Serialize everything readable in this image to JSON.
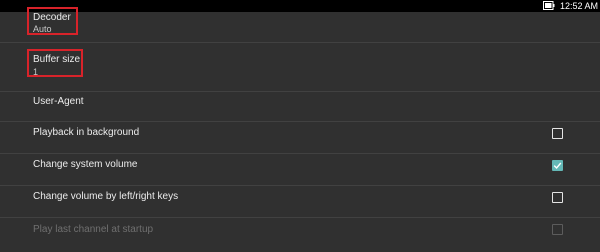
{
  "status_bar": {
    "time": "12:52 AM",
    "battery_icon": "battery-icon"
  },
  "settings": {
    "decoder": {
      "title": "Decoder",
      "summary": "Auto"
    },
    "buffer_size": {
      "title": "Buffer size",
      "summary": "1"
    },
    "user_agent": {
      "title": "User-Agent"
    },
    "playback_background": {
      "title": "Playback in background",
      "checked": false
    },
    "change_system_volume": {
      "title": "Change system volume",
      "checked": true
    },
    "change_volume_keys": {
      "title": "Change volume by left/right keys",
      "checked": false
    },
    "play_last_channel": {
      "title": "Play last channel at startup",
      "checked": false,
      "enabled": false
    }
  },
  "colors": {
    "background": "#303030",
    "accent": "#64b8b6",
    "highlight": "#d8232a"
  }
}
